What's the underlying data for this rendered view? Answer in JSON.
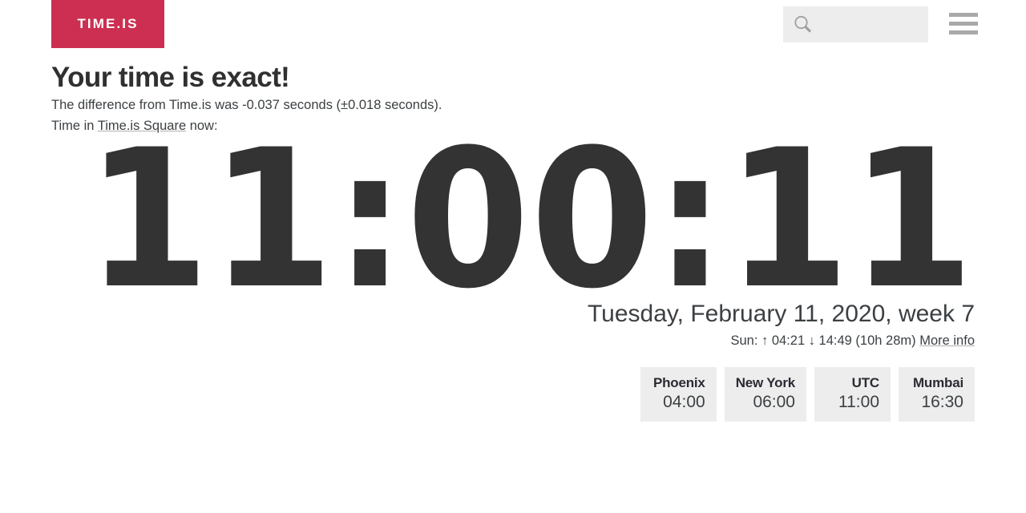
{
  "header": {
    "logo_text": "TIME.IS",
    "logo_color": "#cc2f51",
    "search": {
      "placeholder": "",
      "value": "",
      "icon": "search-icon"
    },
    "menu_icon": "hamburger-menu-icon"
  },
  "main": {
    "headline": "Your time is exact!",
    "difference_line": "The difference from Time.is was -0.037 seconds (±0.018 seconds).",
    "location_line_prefix": "Time in ",
    "location_link": "Time.is Square",
    "location_line_suffix": " now:",
    "clock": "11:00:11",
    "date": "Tuesday, February 11, 2020, week 7",
    "sun_line": "Sun: ↑ 04:21 ↓ 14:49 (10h 28m)",
    "more_info_link": "More info"
  },
  "cities": [
    {
      "name": "Phoenix",
      "time": "04:00"
    },
    {
      "name": "New York",
      "time": "06:00"
    },
    {
      "name": "UTC",
      "time": "11:00"
    },
    {
      "name": "Mumbai",
      "time": "16:30"
    }
  ],
  "colors": {
    "accent": "#cc2f51",
    "text": "#3c4043",
    "clock": "#333333",
    "box_bg": "#ededed",
    "icon_gray": "#a9a9a9"
  }
}
